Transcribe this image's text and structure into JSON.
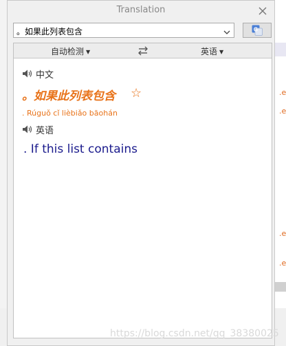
{
  "window": {
    "title": "Translation",
    "close_icon": "close-icon"
  },
  "query": {
    "value": "。如果此列表包含",
    "dropdown_icon": "chevron-down-icon"
  },
  "translate_button": {
    "icon": "google-translate-icon"
  },
  "lang_bar": {
    "source": "自动检测",
    "target": "英语",
    "swap_icon": "swap-arrows-icon"
  },
  "source_section": {
    "language_label": "中文",
    "text": "。如果此列表包含",
    "favorite_icon": "star-outline-icon",
    "pinyin": ". Rúguǒ cǐ lièbiǎo bāohán"
  },
  "target_section": {
    "language_label": "英语",
    "text": ". If this list contains"
  },
  "background": {
    "fragments": [
      ".e",
      ".e",
      ".e",
      ".e"
    ]
  },
  "watermark": "https://blog.csdn.net/qq_38380025",
  "colors": {
    "source_text": "#e8731a",
    "result_text": "#1a1a8c",
    "translate_button_icon": "#4a7fd6"
  }
}
